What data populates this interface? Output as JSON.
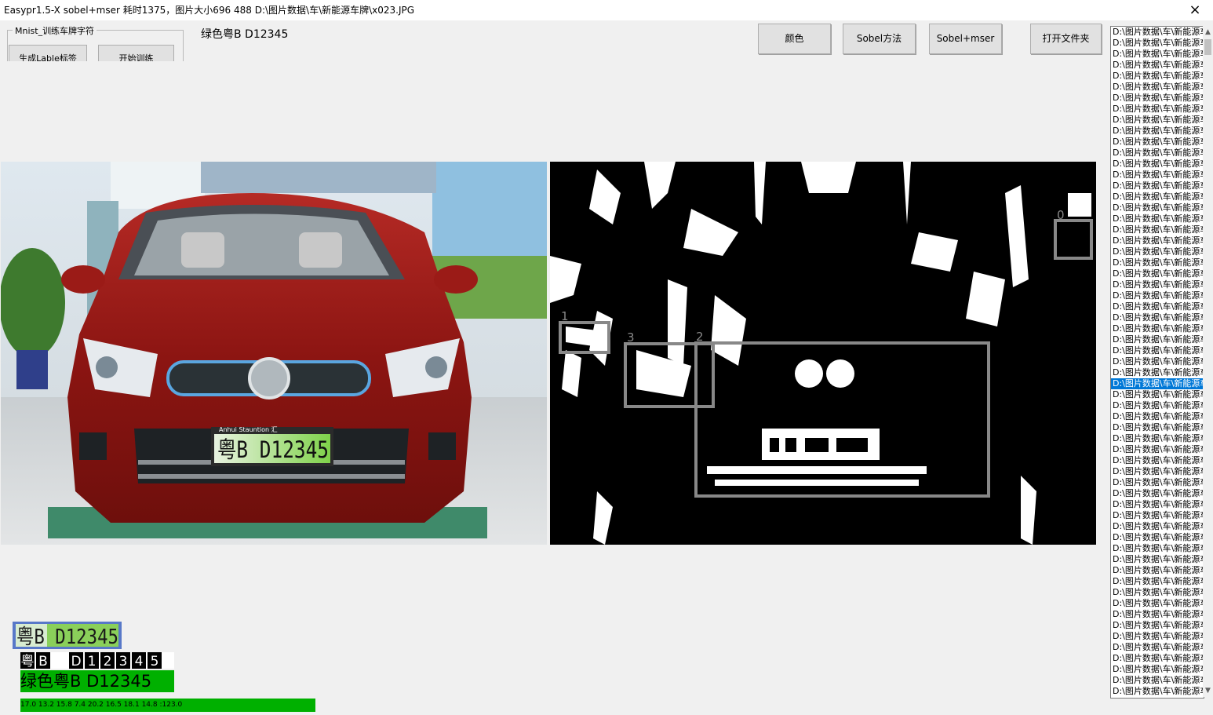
{
  "window": {
    "title": "Easypr1.5-X   sobel+mser 耗时1375，图片大小696 488 D:\\图片数据\\车\\新能源车牌\\x023.JPG",
    "close_glyph": "×"
  },
  "train_group": {
    "legend": "Mnist_训练车牌字符",
    "gen_label_button": "生成Lable标签",
    "start_train_button": "开始训练"
  },
  "result_text": "绿色粤B D12345",
  "toolbar": {
    "color_button": "颜色",
    "sobel_button": "Sobel方法",
    "sobel_mser_button": "Sobel+mser",
    "open_folder_button": "打开文件夹"
  },
  "source_image": {
    "plate_text": "粤B D12345",
    "plate_brand": "Anhui Stauntion 汇"
  },
  "binary_image": {
    "box_labels": [
      "0",
      "1",
      "3",
      "2"
    ]
  },
  "file_list": {
    "item_text": "D:\\图片数据\\车\\新能源车牌",
    "count": 61,
    "selected_index": 32
  },
  "results": {
    "plate_image_text": "粤B D12345",
    "segmented_chars": [
      "粤",
      "B",
      "D",
      "1",
      "2",
      "3",
      "4",
      "5"
    ],
    "label": "绿色粤B D12345",
    "scores": "17.0 13.2 15.8 7.4 20.2 16.5 18.1 14.8  :123.0"
  },
  "colors": {
    "selection": "#0078d7",
    "score_bar": "#00b000",
    "window_bg": "#f0f0f0"
  }
}
